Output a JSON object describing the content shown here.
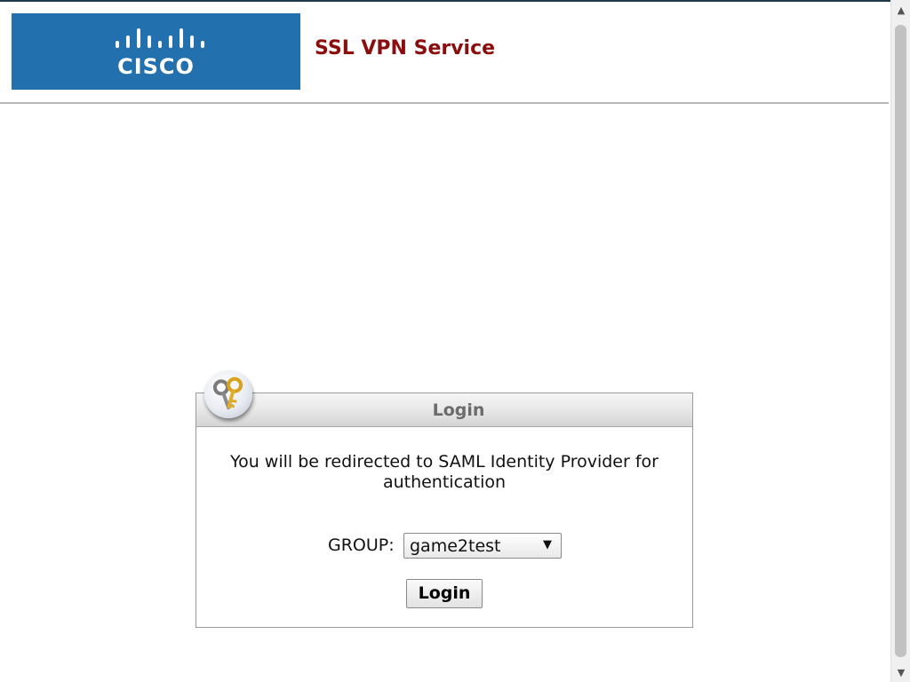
{
  "header": {
    "logo_text": "CISCO",
    "service_title": "SSL VPN Service",
    "brand_color": "#2270ad",
    "title_color": "#8b0d0d"
  },
  "login": {
    "title": "Login",
    "icon": "keys-icon",
    "message": "You will be redirected to SAML Identity Provider for authentication",
    "group_label": "GROUP:",
    "group_selected": "game2test",
    "login_button": "Login"
  },
  "scrollbar": {
    "up_icon": "scroll-up-arrow-icon",
    "down_icon": "scroll-down-arrow-icon"
  }
}
